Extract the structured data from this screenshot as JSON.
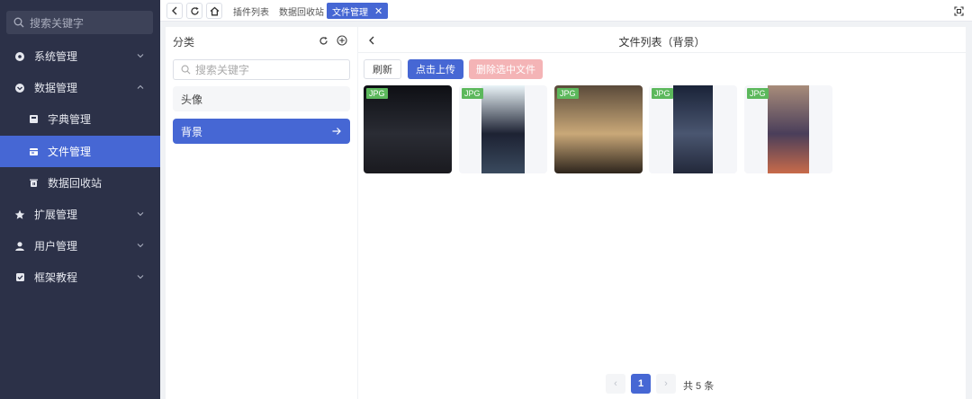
{
  "sidebar": {
    "search_placeholder": "搜索关键字",
    "items": [
      {
        "label": "系统管理",
        "icon": "gear-icon"
      },
      {
        "label": "数据管理",
        "icon": "database-icon"
      },
      {
        "label": "字典管理",
        "icon": "book-icon"
      },
      {
        "label": "文件管理",
        "icon": "file-icon"
      },
      {
        "label": "数据回收站",
        "icon": "trash-icon"
      },
      {
        "label": "扩展管理",
        "icon": "star-icon"
      },
      {
        "label": "用户管理",
        "icon": "user-icon"
      },
      {
        "label": "框架教程",
        "icon": "checklist-icon"
      }
    ],
    "active_index": 3
  },
  "topbar": {
    "tabs": [
      {
        "label": "插件列表"
      },
      {
        "label": "数据回收站"
      },
      {
        "label": "文件管理"
      }
    ],
    "active_tab": 2,
    "close_glyph": "✕"
  },
  "category": {
    "title": "分类",
    "search_placeholder": "搜索关键字",
    "items": [
      {
        "label": "头像"
      },
      {
        "label": "背景"
      }
    ],
    "selected_index": 1
  },
  "files": {
    "title": "文件列表（背景）",
    "buttons": {
      "refresh": "刷新",
      "upload": "点击上传",
      "delete": "删除选中文件"
    },
    "thumbnails": [
      {
        "badge": "JPG",
        "colors": [
          "#0e0f14",
          "#2a2c34",
          "#1a1a1f"
        ]
      },
      {
        "badge": "JPG",
        "colors": [
          "#eaf4f8",
          "#1d2233",
          "#3a4a5e"
        ]
      },
      {
        "badge": "JPG",
        "colors": [
          "#5a4a3a",
          "#c9a878",
          "#2d241c"
        ]
      },
      {
        "badge": "JPG",
        "colors": [
          "#1a2338",
          "#4a5670",
          "#22283a"
        ]
      },
      {
        "badge": "JPG",
        "colors": [
          "#a88c7a",
          "#4a3e5a",
          "#c86a4a"
        ]
      }
    ],
    "pagination": {
      "prev": "‹",
      "current": "1",
      "next": "›",
      "total": "共 5 条"
    }
  },
  "colors": {
    "primary": "#4667d4",
    "sidebar_bg": "#2c3148",
    "danger_light": "#f4b4b6",
    "badge_green": "#5cb85c"
  }
}
